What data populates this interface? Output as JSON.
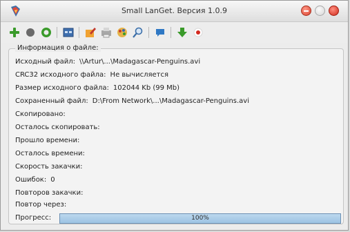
{
  "window": {
    "title": "Small LanGet. Версия 1.0.9"
  },
  "toolbar": {
    "buttons": [
      {
        "name": "add-icon"
      },
      {
        "name": "stop-icon"
      },
      {
        "name": "start-icon"
      },
      {
        "name": "window-icon"
      },
      {
        "name": "edit-icon"
      },
      {
        "name": "print-icon"
      },
      {
        "name": "palette-icon"
      },
      {
        "name": "search-icon"
      },
      {
        "name": "chat-icon"
      },
      {
        "name": "download-arrow-icon"
      },
      {
        "name": "record-icon"
      }
    ]
  },
  "info": {
    "legend": "Информация о файле:",
    "source_file_label": "Исходный файл:",
    "source_file_value": "\\\\Artur\\...\\Madagascar-Penguins.avi",
    "crc_label": "CRC32 исходного файла:",
    "crc_value": "Не вычисляется",
    "size_label": "Размер исходного файла:",
    "size_value": "102044 Kb (99 Mb)",
    "saved_label": "Сохраненный файл:",
    "saved_value": "D:\\From Network\\...\\Madagascar-Penguins.avi",
    "copied_label": "Скопировано:",
    "remaining_label": "Осталось скопировать:",
    "elapsed_label": "Прошло времени:",
    "time_left_label": "Осталось времени:",
    "speed_label": "Скорость закачки:",
    "errors_label": "Ошибок:",
    "errors_value": "0",
    "retries_label": "Повторов закачки:",
    "retry_in_label": "Повтор через:",
    "progress_label": "Прогресс:",
    "progress_text": "100%",
    "progress_value": 1.0
  },
  "colors": {
    "progress_fill": "#a9cce8",
    "accent_red": "#d8402c"
  }
}
